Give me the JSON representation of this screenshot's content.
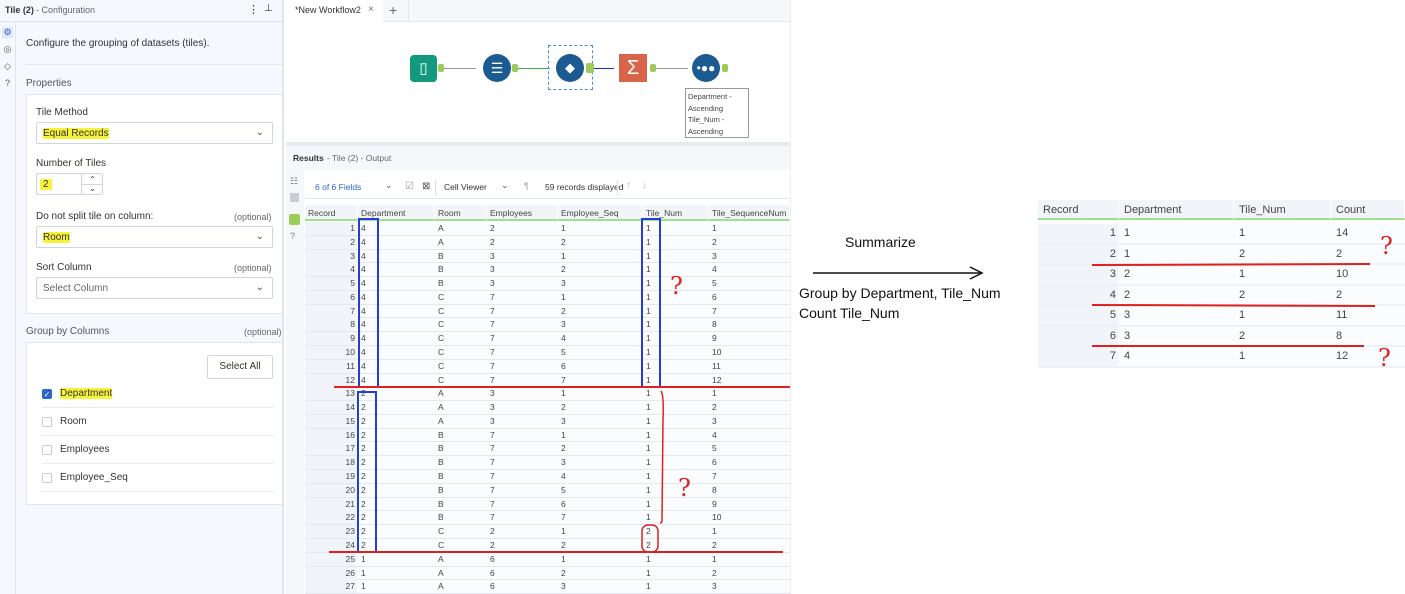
{
  "config": {
    "title": "Tile (2)",
    "subtitle": "- Configuration",
    "description": "Configure the grouping of datasets (tiles).",
    "properties_heading": "Properties",
    "tile_method_label": "Tile Method",
    "tile_method_value": "Equal Records",
    "num_tiles_label": "Number of Tiles",
    "num_tiles_value": "2",
    "no_split_label": "Do not split tile on column:",
    "no_split_value": "Room",
    "sort_label": "Sort Column",
    "sort_placeholder": "Select Column",
    "optional": "(optional)",
    "group_by_label": "Group by Columns",
    "select_all": "Select All",
    "group_columns": [
      {
        "label": "Department",
        "checked": true
      },
      {
        "label": "Room",
        "checked": false
      },
      {
        "label": "Employees",
        "checked": false
      },
      {
        "label": "Employee_Seq",
        "checked": false
      }
    ]
  },
  "workflow": {
    "tab_label": "*New Workflow2",
    "tab_close": "×",
    "add_tab": "+",
    "sort_annotation": [
      "Department -",
      "Ascending",
      "Tile_Num -",
      "Ascending"
    ]
  },
  "results": {
    "title": "Results",
    "subtitle": "- Tile (2) - Output",
    "fields_selector": "6 of 6 Fields",
    "cell_viewer": "Cell Viewer",
    "records_displayed": "59 records displayed",
    "columns": [
      "Record",
      "Department",
      "Room",
      "Employees",
      "Employee_Seq",
      "Tile_Num",
      "Tile_SequenceNum"
    ],
    "rows": [
      [
        1,
        4,
        "A",
        2,
        1,
        1,
        1
      ],
      [
        2,
        4,
        "A",
        2,
        2,
        1,
        2
      ],
      [
        3,
        4,
        "B",
        3,
        1,
        1,
        3
      ],
      [
        4,
        4,
        "B",
        3,
        2,
        1,
        4
      ],
      [
        5,
        4,
        "B",
        3,
        3,
        1,
        5
      ],
      [
        6,
        4,
        "C",
        7,
        1,
        1,
        6
      ],
      [
        7,
        4,
        "C",
        7,
        2,
        1,
        7
      ],
      [
        8,
        4,
        "C",
        7,
        3,
        1,
        8
      ],
      [
        9,
        4,
        "C",
        7,
        4,
        1,
        9
      ],
      [
        10,
        4,
        "C",
        7,
        5,
        1,
        10
      ],
      [
        11,
        4,
        "C",
        7,
        6,
        1,
        11
      ],
      [
        12,
        4,
        "C",
        7,
        7,
        1,
        12
      ],
      [
        13,
        2,
        "A",
        3,
        1,
        1,
        1
      ],
      [
        14,
        2,
        "A",
        3,
        2,
        1,
        2
      ],
      [
        15,
        2,
        "A",
        3,
        3,
        1,
        3
      ],
      [
        16,
        2,
        "B",
        7,
        1,
        1,
        4
      ],
      [
        17,
        2,
        "B",
        7,
        2,
        1,
        5
      ],
      [
        18,
        2,
        "B",
        7,
        3,
        1,
        6
      ],
      [
        19,
        2,
        "B",
        7,
        4,
        1,
        7
      ],
      [
        20,
        2,
        "B",
        7,
        5,
        1,
        8
      ],
      [
        21,
        2,
        "B",
        7,
        6,
        1,
        9
      ],
      [
        22,
        2,
        "B",
        7,
        7,
        1,
        10
      ],
      [
        23,
        2,
        "C",
        2,
        1,
        2,
        1
      ],
      [
        24,
        2,
        "C",
        2,
        2,
        2,
        2
      ],
      [
        25,
        1,
        "A",
        6,
        1,
        1,
        1
      ],
      [
        26,
        1,
        "A",
        6,
        2,
        1,
        2
      ],
      [
        27,
        1,
        "A",
        6,
        3,
        1,
        3
      ]
    ]
  },
  "summary": {
    "columns": [
      "Record",
      "Department",
      "Tile_Num",
      "Count"
    ],
    "rows": [
      [
        1,
        1,
        1,
        14
      ],
      [
        2,
        1,
        2,
        2
      ],
      [
        3,
        2,
        1,
        10
      ],
      [
        4,
        2,
        2,
        2
      ],
      [
        5,
        3,
        1,
        11
      ],
      [
        6,
        3,
        2,
        8
      ],
      [
        7,
        4,
        1,
        12
      ]
    ]
  },
  "annotations": {
    "summarize": "Summarize",
    "group_by": "Group by Department, Tile_Num",
    "count": "Count Tile_Num",
    "question": "?"
  },
  "colors": {
    "highlight": "#f7f23a",
    "annotation_red": "#e02020",
    "annotation_blue": "#1f3fd6",
    "node_blue": "#1c5a92"
  }
}
